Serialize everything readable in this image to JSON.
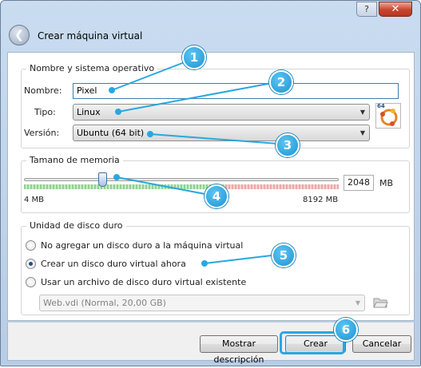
{
  "window": {
    "title": "Crear máquina virtual",
    "help_label": "?",
    "close_label": "✕"
  },
  "name_os": {
    "group_title": "Nombre y sistema operativo",
    "name_label": "Nombre:",
    "name_value": "Pixel",
    "type_label": "Tipo:",
    "type_value": "Linux",
    "version_label": "Versión:",
    "version_value": "Ubuntu (64 bit)",
    "os_icon_badge": "64"
  },
  "memory": {
    "group_title": "Tamano de memoria",
    "value": "2048",
    "unit": "MB",
    "min_label": "4 MB",
    "max_label": "8192 MB",
    "slider_min": 4,
    "slider_max": 8192,
    "slider_value": 2048
  },
  "disk": {
    "group_title": "Unidad de disco duro",
    "options": [
      {
        "label": "No agregar un disco duro a la máquina virtual",
        "checked": false
      },
      {
        "label": "Crear un disco duro virtual ahora",
        "checked": true
      },
      {
        "label": "Usar un archivo de disco duro virtual existente",
        "checked": false
      }
    ],
    "existing_file": "Web.vdi (Normal, 20,00 GB)"
  },
  "buttons": {
    "describe": "Mostrar descripción",
    "create": "Crear",
    "cancel": "Cancelar"
  },
  "callouts": [
    "1",
    "2",
    "3",
    "4",
    "5",
    "6"
  ],
  "colors": {
    "callout": "#29a7e0",
    "titlebar": "#c9dcf0"
  }
}
